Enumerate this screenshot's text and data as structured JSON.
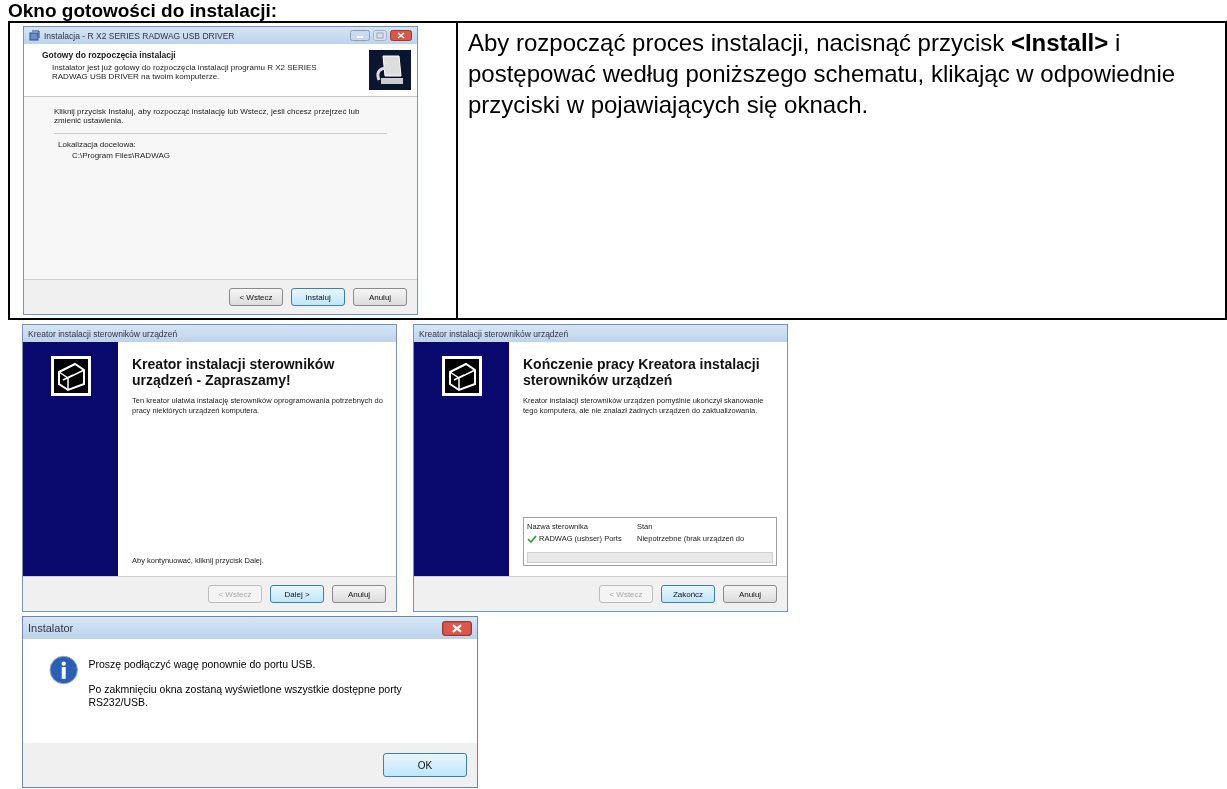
{
  "heading": "Okno gotowości do instalacji:",
  "layout_table": {
    "setup_window": {
      "title": "Instalacja - R X2 SERIES RADWAG USB DRIVER",
      "header_title": "Gotowy do rozpoczęcia instalacji",
      "header_subtitle": "Instalator jest już gotowy do rozpoczęcia instalacji programu R X2 SERIES RADWAG USB DRIVER na twoim komputerze.",
      "body": "Kliknij przycisk Instaluj, aby rozpocząć instalację lub Wstecz, jeśli chcesz przejrzeć lub zmienić ustawienia.",
      "memo_lines": [
        "Lokalizacja docelowa:",
        "C:\\Program Files\\RADWAG"
      ],
      "buttons": [
        {
          "label": "< Wstecz",
          "default": false,
          "disabled": false
        },
        {
          "label": "Instaluj",
          "default": true,
          "disabled": false
        },
        {
          "label": "Anuluj",
          "default": false,
          "disabled": false
        }
      ]
    },
    "instruction": "Aby rozpocząć proces instalacji, nacisnąć przycisk **<Install>** i postępować według poniższego schematu, klikając w odpowiednie przyciski w pojawiających się oknach."
  },
  "wizard_windows": [
    {
      "title": "Kreator instalacji sterowników urządzeń",
      "heading": "Kreator instalacji sterowników urządzeń - Zapraszamy!",
      "text": "Ten kreator ułatwia instalację sterowników oprogramowania potrzebnych do pracy niektórych urządzeń komputera.",
      "footer": "Aby kontynuować, kliknij przycisk Dalej.",
      "buttons": [
        {
          "label": "< Wstecz",
          "default": false,
          "disabled": true
        },
        {
          "label": "Dalej >",
          "default": true,
          "disabled": false
        },
        {
          "label": "Anuluj",
          "default": false,
          "disabled": false
        }
      ]
    },
    {
      "title": "Kreator instalacji sterowników urządzeń",
      "heading": "Kończenie pracy Kreatora instalacji sterowników urządzeń",
      "text": "Kreator instalacji sterowników urządzeń pomyślnie ukończył skanowanie tego komputera, ale nie znalazł żadnych urządzeń do zaktualizowania.",
      "driver_list": {
        "columns": [
          "Nazwa sterownika",
          "Stan"
        ],
        "rows": [
          {
            "name": "RADWAG (usbser) Ports",
            "status": "Niepotrzebne (brak urządzeń do"
          }
        ]
      },
      "buttons": [
        {
          "label": "< Wstecz",
          "default": false,
          "disabled": true
        },
        {
          "label": "Zakończ",
          "default": true,
          "disabled": false
        },
        {
          "label": "Anuluj",
          "default": false,
          "disabled": false
        }
      ]
    }
  ],
  "message_dialog": {
    "title": "Instalator",
    "messages": [
      "Proszę podłączyć wagę ponownie do portu USB.",
      "Po zakmnięciu okna zostaną wyświetlone wszystkie dostępne porty RS232/USB."
    ],
    "button": "OK"
  }
}
